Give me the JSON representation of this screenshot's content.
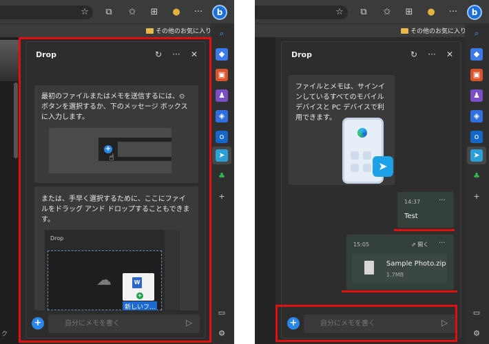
{
  "left": {
    "favorites": "その他のお気に入り",
    "panel_title": "Drop",
    "card1_text": "最初のファイルまたはメモを送信するには、⊙ ボタンを選択するか、下のメッセージ ボックスに入力します。",
    "card2_text": "または、手早く選択するために、ここにファイルをドラッグ アンド ドロップすることもできます。",
    "mini_title": "Drop",
    "drag_label": "新しいフ...",
    "word_glyph": "W",
    "composer_placeholder": "自分にメモを書く",
    "page_edge_text": "ク"
  },
  "right": {
    "favorites": "その他のお気に入り",
    "panel_title": "Drop",
    "card_text": "ファイルとメモは、サインインしているすべてのモバイル デバイスと PC デバイスで利用できます。",
    "message": {
      "time": "14:37",
      "text": "Test"
    },
    "file_message": {
      "time": "15:05",
      "open": "開く",
      "name": "Sample Photo.zip",
      "size": "1.7MB"
    },
    "composer_placeholder": "自分にメモを書く"
  },
  "icons": {
    "more": "···",
    "close": "✕",
    "refresh": "↻",
    "plus": "+",
    "send": "▷",
    "copilot": "b"
  },
  "colors": {
    "accent": "#2a86e8",
    "highlight": "#e01010",
    "panel": "#2d2d2d"
  }
}
